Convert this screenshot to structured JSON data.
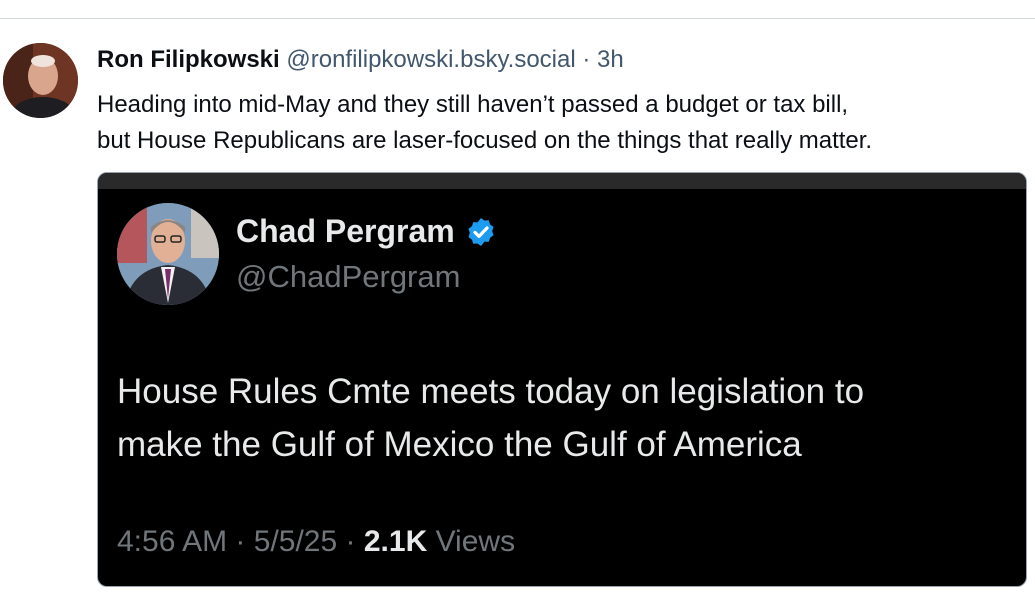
{
  "post": {
    "author_name": "Ron Filipkowski",
    "author_handle": "@ronfilipkowski.bsky.social",
    "separator": "·",
    "time_ago": "3h",
    "text_line1": "Heading into mid-May and they still haven’t passed a budget or tax bill,",
    "text_line2": "but House Republicans are laser-focused on the things that really matter."
  },
  "embed": {
    "author_name": "Chad Pergram",
    "author_handle": "@ChadPergram",
    "verified_icon": "verified-badge-icon",
    "text_line1": "House Rules Cmte meets today on legislation to",
    "text_line2": "make the Gulf of Mexico the Gulf of America",
    "time": "4:56 AM",
    "date": "5/5/25",
    "separator": "·",
    "views_count": "2.1K",
    "views_label": "Views"
  },
  "colors": {
    "verified_blue": "#1d9bf0",
    "embed_background": "#000000",
    "handle_gray": "#42576c"
  }
}
